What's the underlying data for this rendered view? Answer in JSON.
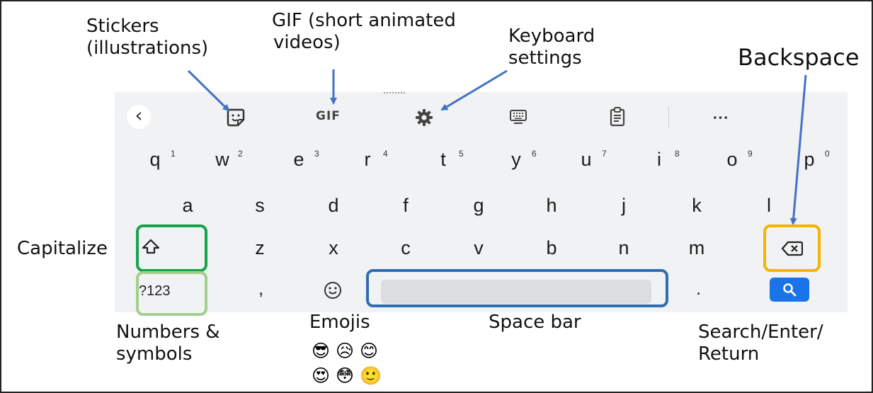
{
  "labels": {
    "stickers": [
      "Stickers",
      "(illustrations)"
    ],
    "gif": [
      "GIF (short animated",
      "videos)"
    ],
    "settings": [
      "Keyboard",
      "settings"
    ],
    "backspace": "Backspace",
    "capitalize": "Capitalize",
    "numbers": [
      "Numbers &",
      "symbols"
    ],
    "emojis": "Emojis",
    "space_bar": "Space bar",
    "search": [
      "Search/Enter/",
      "Return"
    ]
  },
  "toolbar": {
    "back": "‹",
    "gif": "GIF",
    "more": "•••"
  },
  "keyboard": {
    "row1": [
      "q",
      "w",
      "e",
      "r",
      "t",
      "y",
      "u",
      "i",
      "o",
      "p"
    ],
    "row1_hints": [
      "1",
      "2",
      "3",
      "4",
      "5",
      "6",
      "7",
      "8",
      "9",
      "0"
    ],
    "row2": [
      "a",
      "s",
      "d",
      "f",
      "g",
      "h",
      "j",
      "k",
      "l"
    ],
    "row3": [
      "z",
      "x",
      "c",
      "v",
      "b",
      "n",
      "m"
    ],
    "symbols_key": "?123",
    "comma": ",",
    "period": "."
  },
  "emoji_samples": [
    "😎",
    "😥",
    "😊",
    "😍",
    "😳",
    "🙂"
  ],
  "colors": {
    "capitalize_box": "#16a34a",
    "numbers_box": "#a3cf8d",
    "space_box": "#2f6db3",
    "backspace_box": "#f4b400",
    "search_key": "#1a73e8",
    "arrow": "#4472c4"
  }
}
